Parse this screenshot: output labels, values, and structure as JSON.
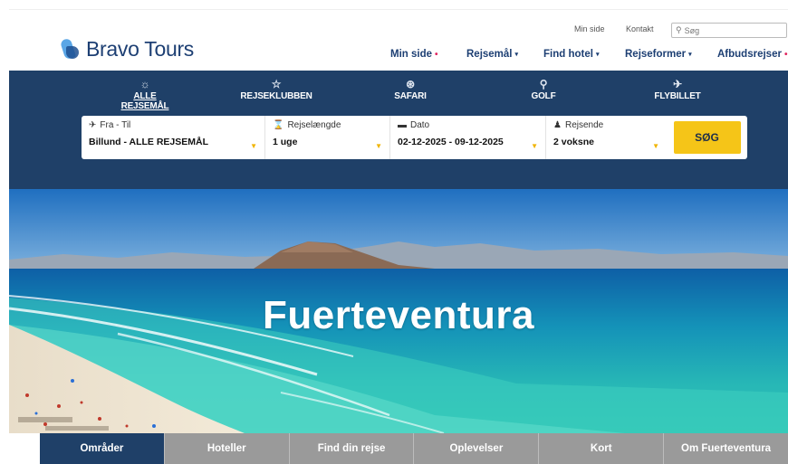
{
  "header": {
    "logo_text": "Bravo Tours",
    "util_links": {
      "min_side": "Min side",
      "kontakt": "Kontakt"
    },
    "search": {
      "placeholder": "Søg",
      "icon": "search-icon"
    },
    "nav": [
      {
        "label": "Min side",
        "dot": true
      },
      {
        "label": "Rejsemål",
        "dropdown": true
      },
      {
        "label": "Find hotel",
        "dropdown": true
      },
      {
        "label": "Rejseformer",
        "dropdown": true
      },
      {
        "label": "Afbudsrejser",
        "dot": true
      }
    ],
    "dot_glyph": "•",
    "caret_glyph": "▾"
  },
  "categories": [
    {
      "label": "ALLE REJSEMÅL",
      "icon": "globe-icon",
      "glyph": "☼",
      "active": true
    },
    {
      "label": "REJSEKLUBBEN",
      "icon": "star-icon",
      "glyph": "☆"
    },
    {
      "label": "SAFARI",
      "icon": "safari-icon",
      "glyph": "⊛"
    },
    {
      "label": "GOLF",
      "icon": "golf-icon",
      "glyph": "⚲"
    },
    {
      "label": "FLYBILLET",
      "icon": "plane-icon",
      "glyph": "✈"
    }
  ],
  "search_form": {
    "from_to": {
      "label": "Fra - Til",
      "value": "Billund - ALLE REJSEMÅL"
    },
    "duration": {
      "label": "Rejselængde",
      "value": "1 uge"
    },
    "date": {
      "label": "Dato",
      "value": "02-12-2025 - 09-12-2025"
    },
    "travellers": {
      "label": "Rejsende",
      "value": "2 voksne"
    },
    "submit_label": "SØG"
  },
  "hero": {
    "title": "Fuerteventura"
  },
  "tabs": [
    {
      "label": "Områder",
      "active": true
    },
    {
      "label": "Hoteller"
    },
    {
      "label": "Find din rejse"
    },
    {
      "label": "Oplevelser"
    },
    {
      "label": "Kort"
    },
    {
      "label": "Om Fuerteventura"
    }
  ],
  "colors": {
    "brand_navy": "#1f4068",
    "logo_blue": "#5aa6e6",
    "accent_yellow": "#f5c518",
    "dot_pink": "#e0245e",
    "tab_grey": "#9a9a9a"
  }
}
